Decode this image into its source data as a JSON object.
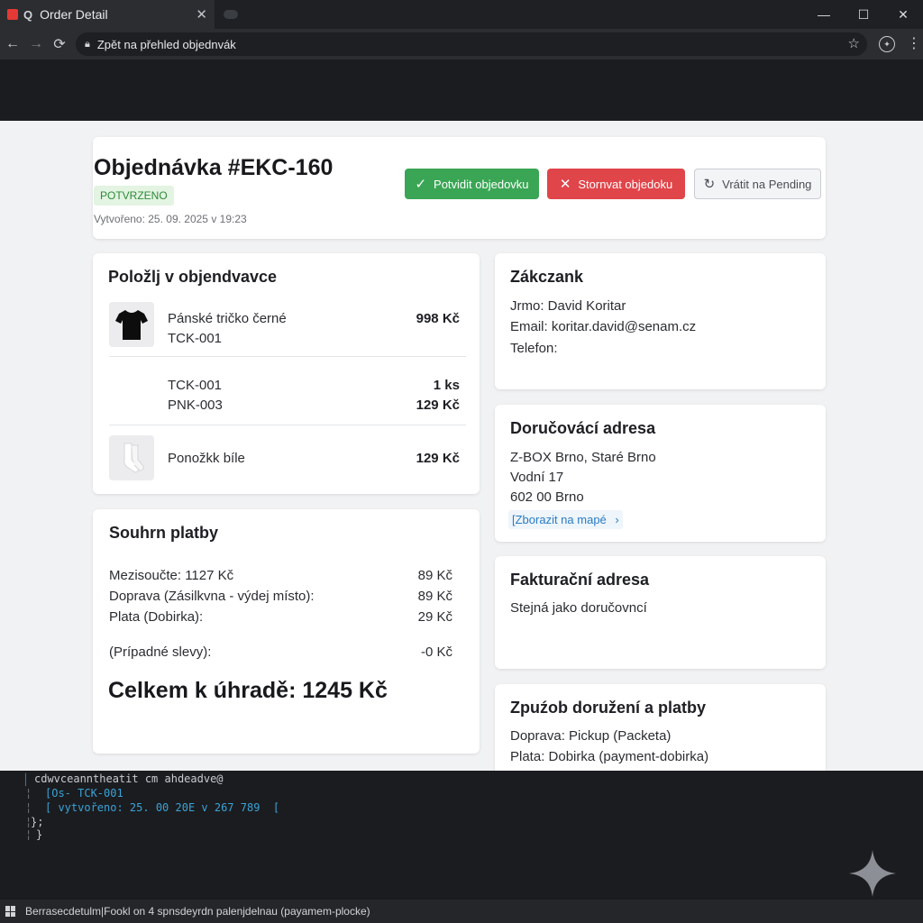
{
  "browser": {
    "tab_title": "Order Detail",
    "tab_icon_glyph": "Q",
    "address": "Zpět na přehled objednvák"
  },
  "order": {
    "title": "Objednávka #EKC-160",
    "status": "POTVRZENO",
    "created": "Vytvořeno: 25. 09. 2025 v 19:23",
    "actions": {
      "confirm": "Potvidit objedovku",
      "cancel": "Stornvat objedoku",
      "pending": "Vrátit na Pending"
    }
  },
  "items": {
    "title": "Položlj v objendvavce",
    "rows": [
      {
        "lines": [
          "Pánské tričko černé",
          "TCK-001"
        ],
        "values": [
          "998 Kč"
        ],
        "icon": "tshirt-icon"
      },
      {
        "lines": [
          "TCK-001",
          "PNK-003"
        ],
        "values": [
          "1 ks",
          "129 Kč"
        ],
        "icon": ""
      },
      {
        "lines": [
          "Ponožkk bíle"
        ],
        "values": [
          "129 Kč"
        ],
        "icon": "socks-icon"
      }
    ]
  },
  "summary": {
    "title": "Souhrn platby",
    "rows": [
      {
        "label": "Mezisoučte: 1127 Kč",
        "value": "89 Kč"
      },
      {
        "label": "Doprava (Zásilkvna - výdej místo):",
        "value": "89 Kč"
      },
      {
        "label": "Plata (Dobirka):",
        "value": "29 Kč"
      },
      {
        "label": "(Prípadné slevy):",
        "value": "-0 Kč"
      }
    ],
    "total": "Celkem k úhradě: 1245 Kč"
  },
  "customer": {
    "title": "Zákczank",
    "name": "Jrmo: David Koritar",
    "email": "Email: koritar.david@senam.cz",
    "phone": "Telefon:"
  },
  "delivery_address": {
    "title": "Doručovácí adresa",
    "line1": "Z-BOX Brno, Staré Brno",
    "line2": "Vodní 17",
    "line3": "602 00 Brno",
    "map_link": "[Zborazit na mapé",
    "map_arrow": "›"
  },
  "billing_address": {
    "title": "Fakturační adresa",
    "text": "Stejná jako doručovncí"
  },
  "shipping": {
    "title": "Zpuźob doružení a platby",
    "transport": "Doprava: Pickup (Packeta)",
    "payment": "Plata: Dobirka (payment-dobirka)"
  },
  "console": {
    "line1": "cdwvceanntheatit cm ahdeadve@",
    "line2": "[Os- TCK-001",
    "line3": "[ vytvořeno: 25. 00 20E v 267 789  [",
    "line4": "};",
    "line5": "}"
  },
  "statusbar": {
    "text": "Berrasecdetulm|Fookl on 4 spnsdeyrdn palenjdelnau (payamem-plocke)"
  },
  "colors": {
    "confirm": "#3aa655",
    "cancel": "#e0454a",
    "status_bg": "#e3f4e2",
    "status_text": "#2f8a39",
    "link": "#2a7bc4"
  }
}
